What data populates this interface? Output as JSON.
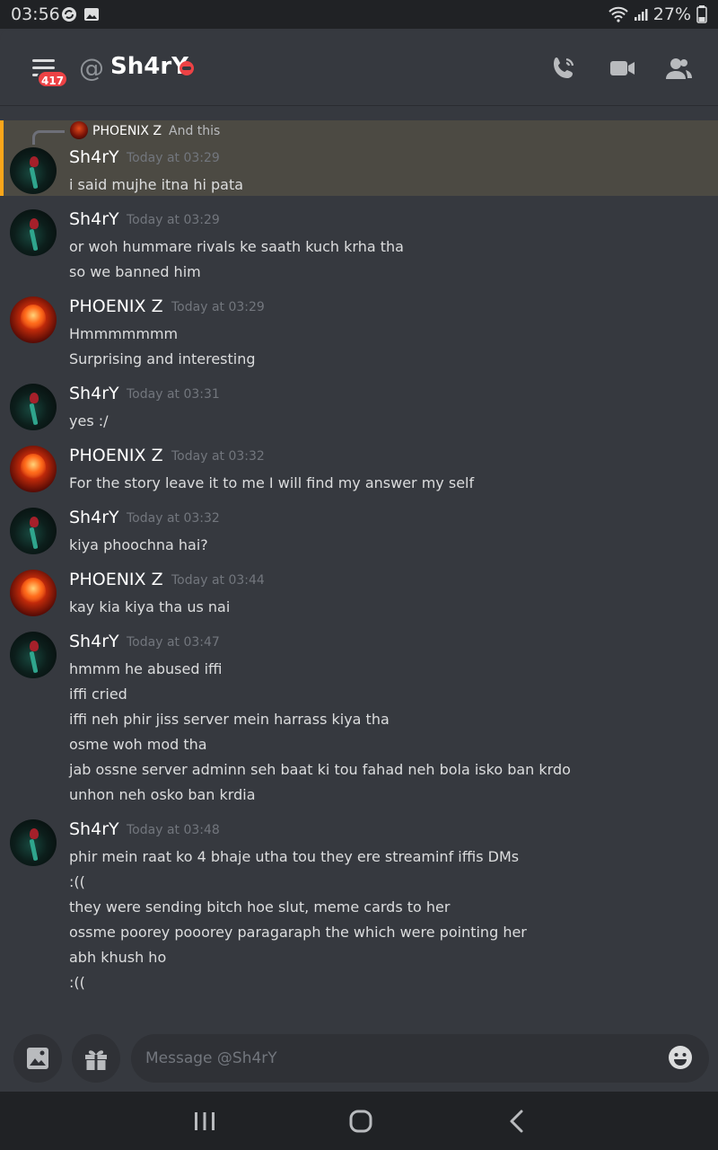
{
  "status_bar": {
    "time": "03:56",
    "battery": "27%"
  },
  "header": {
    "unread_badge": "417",
    "at_symbol": "@",
    "title": "Sh4rY"
  },
  "reply_preview": {
    "author": "PHOENIX Z",
    "text": "And this"
  },
  "messages": [
    {
      "author": "Sh4rY",
      "timestamp": "Today at 03:29",
      "lines": [
        "i said mujhe itna hi pata"
      ]
    },
    {
      "author": "Sh4rY",
      "timestamp": "Today at 03:29",
      "lines": [
        "or woh hummare rivals ke saath kuch krha tha",
        "so we banned him"
      ]
    },
    {
      "author": "PHOENIX Z",
      "timestamp": "Today at 03:29",
      "lines": [
        "Hmmmmmmm",
        "Surprising and interesting"
      ]
    },
    {
      "author": "Sh4rY",
      "timestamp": "Today at 03:31",
      "lines": [
        "yes :/"
      ]
    },
    {
      "author": "PHOENIX Z",
      "timestamp": "Today at 03:32",
      "lines": [
        "For the story leave it to me I will find my answer my self"
      ]
    },
    {
      "author": "Sh4rY",
      "timestamp": "Today at 03:32",
      "lines": [
        "kiya phoochna hai?"
      ]
    },
    {
      "author": "PHOENIX Z",
      "timestamp": "Today at 03:44",
      "lines": [
        "kay kia kiya tha us nai"
      ]
    },
    {
      "author": "Sh4rY",
      "timestamp": "Today at 03:47",
      "lines": [
        "hmmm he abused iffi",
        "iffi cried",
        "iffi neh phir jiss server mein harrass kiya tha",
        "osme woh mod tha",
        "jab ossne server adminn seh baat ki tou fahad neh bola isko ban krdo",
        "unhon neh osko ban krdia"
      ]
    },
    {
      "author": "Sh4rY",
      "timestamp": "Today at 03:48",
      "lines": [
        "phir mein raat ko 4 bhaje utha tou they ere streaminf iffis DMs",
        ":((",
        "they were sending bitch hoe slut, meme cards to her",
        "ossme poorey pooorey paragaraph the which were pointing her",
        "abh khush ho",
        ":(("
      ]
    }
  ],
  "composer": {
    "placeholder": "Message @Sh4rY"
  },
  "colors": {
    "background": "#36393f",
    "highlight": "#4c4a43",
    "highlight_bar": "#faa61a",
    "badge": "#ed4245"
  }
}
